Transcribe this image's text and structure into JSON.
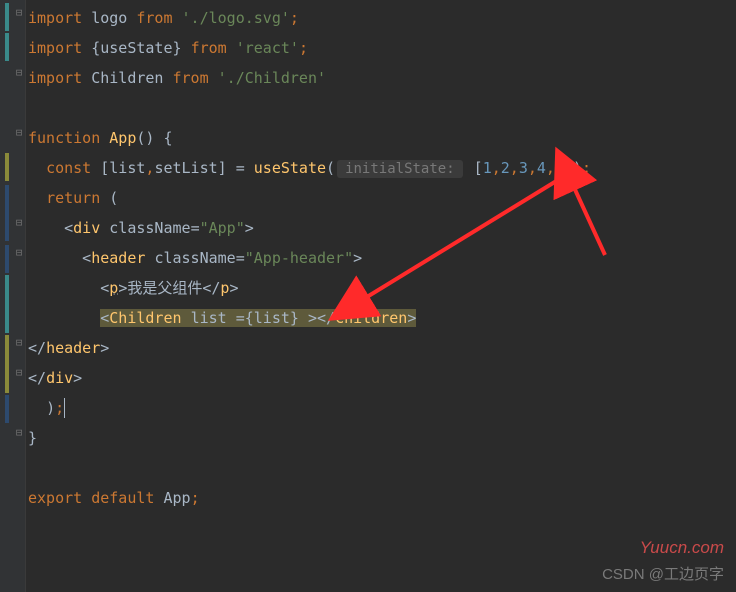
{
  "lines": {
    "l1_import": "import",
    "l1_logo": " logo ",
    "l1_from": "from",
    "l1_path": " './logo.svg'",
    "l1_semi": ";",
    "l2_import": "import",
    "l2_us": " {useState} ",
    "l2_from": "from",
    "l2_path": " 'react'",
    "l2_semi": ";",
    "l3_import": "import",
    "l3_ch": " Children ",
    "l3_from": "from",
    "l3_path": " './Children'",
    "l5_fn": "function",
    "l5_name": " App",
    "l5_pl": "() {",
    "l6_pre": "  ",
    "l6_const": "const",
    "l6_mid": " [list",
    "l6_comma": ",",
    "l6_set": "setList] = ",
    "l6_use": "useState",
    "l6_po": "(",
    "l6_hint": "initialState:",
    "l6_b1": " [",
    "l6_n1": "1",
    "l6_c": ",",
    "l6_n2": "2",
    "l6_n3": "3",
    "l6_n4": "4",
    "l6_n5": "5",
    "l6_b2": "])",
    "l6_semi": ";",
    "l7_pre": "  ",
    "l7_ret": "return",
    "l7_p": " (",
    "l8_pre": "    <",
    "l8_div": "div ",
    "l8_cn": "className",
    "l8_eq": "=",
    "l8_val": "\"App\"",
    "l8_gt": ">",
    "l9_pre": "      <",
    "l9_hdr": "header ",
    "l9_cn": "className",
    "l9_eq": "=",
    "l9_val": "\"App-header\"",
    "l9_gt": ">",
    "l10_pre": "        <",
    "l10_p": "p",
    "l10_gt": ">",
    "l10_txt": "我是父组件",
    "l10_lt": "</",
    "l10_p2": "p",
    "l10_gt2": ">",
    "l11_pre": "        ",
    "l11_lt": "<",
    "l11_ch": "Children ",
    "l11_list": "list ",
    "l11_eq": "=",
    "l11_br": "{list} ",
    "l11_gt": ">",
    "l11_lt2": "</",
    "l11_ch2": "Children",
    "l11_gt2": ">",
    "l12_txt": "</",
    "l12_hdr": "header",
    "l12_gt": ">",
    "l13_txt": "</",
    "l13_div": "div",
    "l13_gt": ">",
    "l14_pre": "  ",
    "l14_p": ")",
    "l14_semi": ";",
    "l15_br": "}",
    "l17_exp": "export default",
    "l17_app": " App",
    "l17_semi": ";"
  },
  "watermark": "Yuucn.com",
  "csdn": "CSDN @工边页字"
}
